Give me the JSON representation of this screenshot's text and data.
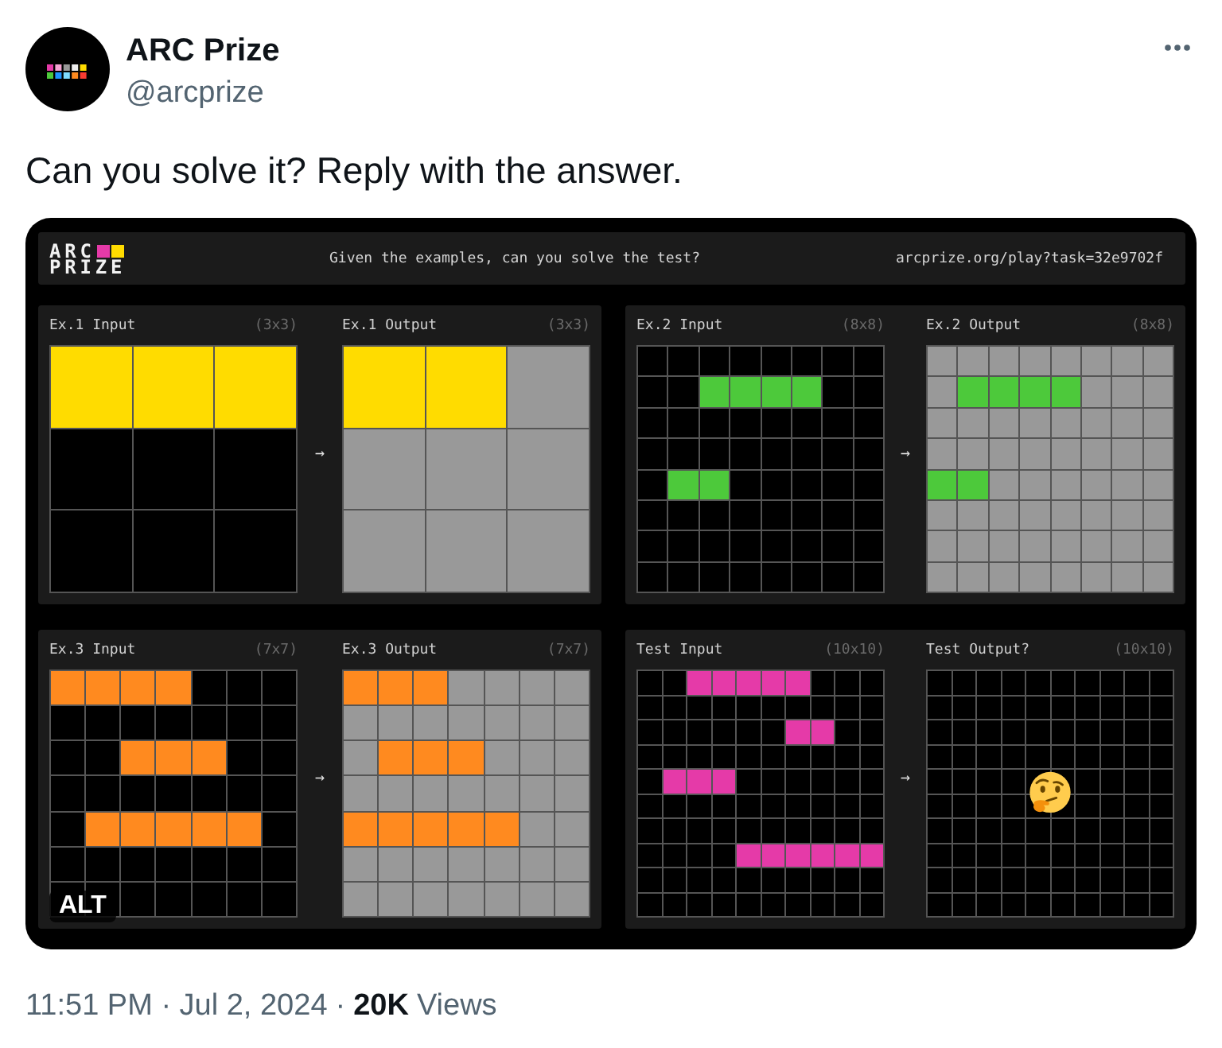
{
  "author": {
    "name": "ARC Prize",
    "handle": "@arcprize"
  },
  "tweet": {
    "text": "Can you solve it? Reply with the answer."
  },
  "media": {
    "header": {
      "logo_line_1": "ARC",
      "logo_line_2": "PRIZE",
      "prompt": "Given the examples, can you solve the test?",
      "url": "arcprize.org/play?task=32e9702f"
    },
    "panels": [
      {
        "kind": "example",
        "arrow": "→",
        "input": {
          "title": "Ex.1 Input",
          "size": "(3x3)",
          "rows": [
            {
              "cells": [
                {
                  "color": "#ffdc00"
                },
                {
                  "color": "#ffdc00"
                },
                {
                  "color": "#ffdc00"
                }
              ]
            },
            {
              "cells": [
                {
                  "color": "#000000"
                },
                {
                  "color": "#000000"
                },
                {
                  "color": "#000000"
                }
              ]
            },
            {
              "cells": [
                {
                  "color": "#000000"
                },
                {
                  "color": "#000000"
                },
                {
                  "color": "#000000"
                }
              ]
            }
          ]
        },
        "output": {
          "title": "Ex.1 Output",
          "size": "(3x3)",
          "rows": [
            {
              "cells": [
                {
                  "color": "#ffdc00"
                },
                {
                  "color": "#ffdc00"
                },
                {
                  "color": "#999999"
                }
              ]
            },
            {
              "cells": [
                {
                  "color": "#999999"
                },
                {
                  "color": "#999999"
                },
                {
                  "color": "#999999"
                }
              ]
            },
            {
              "cells": [
                {
                  "color": "#999999"
                },
                {
                  "color": "#999999"
                },
                {
                  "color": "#999999"
                }
              ]
            }
          ]
        }
      },
      {
        "kind": "example",
        "arrow": "→",
        "input": {
          "title": "Ex.2 Input",
          "size": "(8x8)",
          "rows": [
            {
              "cells": [
                {
                  "color": "#000000"
                },
                {
                  "color": "#000000"
                },
                {
                  "color": "#000000"
                },
                {
                  "color": "#000000"
                },
                {
                  "color": "#000000"
                },
                {
                  "color": "#000000"
                },
                {
                  "color": "#000000"
                },
                {
                  "color": "#000000"
                }
              ]
            },
            {
              "cells": [
                {
                  "color": "#000000"
                },
                {
                  "color": "#000000"
                },
                {
                  "color": "#4dc93b"
                },
                {
                  "color": "#4dc93b"
                },
                {
                  "color": "#4dc93b"
                },
                {
                  "color": "#4dc93b"
                },
                {
                  "color": "#000000"
                },
                {
                  "color": "#000000"
                }
              ]
            },
            {
              "cells": [
                {
                  "color": "#000000"
                },
                {
                  "color": "#000000"
                },
                {
                  "color": "#000000"
                },
                {
                  "color": "#000000"
                },
                {
                  "color": "#000000"
                },
                {
                  "color": "#000000"
                },
                {
                  "color": "#000000"
                },
                {
                  "color": "#000000"
                }
              ]
            },
            {
              "cells": [
                {
                  "color": "#000000"
                },
                {
                  "color": "#000000"
                },
                {
                  "color": "#000000"
                },
                {
                  "color": "#000000"
                },
                {
                  "color": "#000000"
                },
                {
                  "color": "#000000"
                },
                {
                  "color": "#000000"
                },
                {
                  "color": "#000000"
                }
              ]
            },
            {
              "cells": [
                {
                  "color": "#000000"
                },
                {
                  "color": "#4dc93b"
                },
                {
                  "color": "#4dc93b"
                },
                {
                  "color": "#000000"
                },
                {
                  "color": "#000000"
                },
                {
                  "color": "#000000"
                },
                {
                  "color": "#000000"
                },
                {
                  "color": "#000000"
                }
              ]
            },
            {
              "cells": [
                {
                  "color": "#000000"
                },
                {
                  "color": "#000000"
                },
                {
                  "color": "#000000"
                },
                {
                  "color": "#000000"
                },
                {
                  "color": "#000000"
                },
                {
                  "color": "#000000"
                },
                {
                  "color": "#000000"
                },
                {
                  "color": "#000000"
                }
              ]
            },
            {
              "cells": [
                {
                  "color": "#000000"
                },
                {
                  "color": "#000000"
                },
                {
                  "color": "#000000"
                },
                {
                  "color": "#000000"
                },
                {
                  "color": "#000000"
                },
                {
                  "color": "#000000"
                },
                {
                  "color": "#000000"
                },
                {
                  "color": "#000000"
                }
              ]
            },
            {
              "cells": [
                {
                  "color": "#000000"
                },
                {
                  "color": "#000000"
                },
                {
                  "color": "#000000"
                },
                {
                  "color": "#000000"
                },
                {
                  "color": "#000000"
                },
                {
                  "color": "#000000"
                },
                {
                  "color": "#000000"
                },
                {
                  "color": "#000000"
                }
              ]
            }
          ]
        },
        "output": {
          "title": "Ex.2 Output",
          "size": "(8x8)",
          "rows": [
            {
              "cells": [
                {
                  "color": "#999999"
                },
                {
                  "color": "#999999"
                },
                {
                  "color": "#999999"
                },
                {
                  "color": "#999999"
                },
                {
                  "color": "#999999"
                },
                {
                  "color": "#999999"
                },
                {
                  "color": "#999999"
                },
                {
                  "color": "#999999"
                }
              ]
            },
            {
              "cells": [
                {
                  "color": "#999999"
                },
                {
                  "color": "#4dc93b"
                },
                {
                  "color": "#4dc93b"
                },
                {
                  "color": "#4dc93b"
                },
                {
                  "color": "#4dc93b"
                },
                {
                  "color": "#999999"
                },
                {
                  "color": "#999999"
                },
                {
                  "color": "#999999"
                }
              ]
            },
            {
              "cells": [
                {
                  "color": "#999999"
                },
                {
                  "color": "#999999"
                },
                {
                  "color": "#999999"
                },
                {
                  "color": "#999999"
                },
                {
                  "color": "#999999"
                },
                {
                  "color": "#999999"
                },
                {
                  "color": "#999999"
                },
                {
                  "color": "#999999"
                }
              ]
            },
            {
              "cells": [
                {
                  "color": "#999999"
                },
                {
                  "color": "#999999"
                },
                {
                  "color": "#999999"
                },
                {
                  "color": "#999999"
                },
                {
                  "color": "#999999"
                },
                {
                  "color": "#999999"
                },
                {
                  "color": "#999999"
                },
                {
                  "color": "#999999"
                }
              ]
            },
            {
              "cells": [
                {
                  "color": "#4dc93b"
                },
                {
                  "color": "#4dc93b"
                },
                {
                  "color": "#999999"
                },
                {
                  "color": "#999999"
                },
                {
                  "color": "#999999"
                },
                {
                  "color": "#999999"
                },
                {
                  "color": "#999999"
                },
                {
                  "color": "#999999"
                }
              ]
            },
            {
              "cells": [
                {
                  "color": "#999999"
                },
                {
                  "color": "#999999"
                },
                {
                  "color": "#999999"
                },
                {
                  "color": "#999999"
                },
                {
                  "color": "#999999"
                },
                {
                  "color": "#999999"
                },
                {
                  "color": "#999999"
                },
                {
                  "color": "#999999"
                }
              ]
            },
            {
              "cells": [
                {
                  "color": "#999999"
                },
                {
                  "color": "#999999"
                },
                {
                  "color": "#999999"
                },
                {
                  "color": "#999999"
                },
                {
                  "color": "#999999"
                },
                {
                  "color": "#999999"
                },
                {
                  "color": "#999999"
                },
                {
                  "color": "#999999"
                }
              ]
            },
            {
              "cells": [
                {
                  "color": "#999999"
                },
                {
                  "color": "#999999"
                },
                {
                  "color": "#999999"
                },
                {
                  "color": "#999999"
                },
                {
                  "color": "#999999"
                },
                {
                  "color": "#999999"
                },
                {
                  "color": "#999999"
                },
                {
                  "color": "#999999"
                }
              ]
            }
          ]
        }
      },
      {
        "kind": "example",
        "arrow": "→",
        "input": {
          "title": "Ex.3 Input",
          "size": "(7x7)",
          "rows": [
            {
              "cells": [
                {
                  "color": "#ff8a1f"
                },
                {
                  "color": "#ff8a1f"
                },
                {
                  "color": "#ff8a1f"
                },
                {
                  "color": "#ff8a1f"
                },
                {
                  "color": "#000000"
                },
                {
                  "color": "#000000"
                },
                {
                  "color": "#000000"
                }
              ]
            },
            {
              "cells": [
                {
                  "color": "#000000"
                },
                {
                  "color": "#000000"
                },
                {
                  "color": "#000000"
                },
                {
                  "color": "#000000"
                },
                {
                  "color": "#000000"
                },
                {
                  "color": "#000000"
                },
                {
                  "color": "#000000"
                }
              ]
            },
            {
              "cells": [
                {
                  "color": "#000000"
                },
                {
                  "color": "#000000"
                },
                {
                  "color": "#ff8a1f"
                },
                {
                  "color": "#ff8a1f"
                },
                {
                  "color": "#ff8a1f"
                },
                {
                  "color": "#000000"
                },
                {
                  "color": "#000000"
                }
              ]
            },
            {
              "cells": [
                {
                  "color": "#000000"
                },
                {
                  "color": "#000000"
                },
                {
                  "color": "#000000"
                },
                {
                  "color": "#000000"
                },
                {
                  "color": "#000000"
                },
                {
                  "color": "#000000"
                },
                {
                  "color": "#000000"
                }
              ]
            },
            {
              "cells": [
                {
                  "color": "#000000"
                },
                {
                  "color": "#ff8a1f"
                },
                {
                  "color": "#ff8a1f"
                },
                {
                  "color": "#ff8a1f"
                },
                {
                  "color": "#ff8a1f"
                },
                {
                  "color": "#ff8a1f"
                },
                {
                  "color": "#000000"
                }
              ]
            },
            {
              "cells": [
                {
                  "color": "#000000"
                },
                {
                  "color": "#000000"
                },
                {
                  "color": "#000000"
                },
                {
                  "color": "#000000"
                },
                {
                  "color": "#000000"
                },
                {
                  "color": "#000000"
                },
                {
                  "color": "#000000"
                }
              ]
            },
            {
              "cells": [
                {
                  "color": "#000000"
                },
                {
                  "color": "#000000"
                },
                {
                  "color": "#000000"
                },
                {
                  "color": "#000000"
                },
                {
                  "color": "#000000"
                },
                {
                  "color": "#000000"
                },
                {
                  "color": "#000000"
                }
              ]
            }
          ]
        },
        "output": {
          "title": "Ex.3 Output",
          "size": "(7x7)",
          "rows": [
            {
              "cells": [
                {
                  "color": "#ff8a1f"
                },
                {
                  "color": "#ff8a1f"
                },
                {
                  "color": "#ff8a1f"
                },
                {
                  "color": "#999999"
                },
                {
                  "color": "#999999"
                },
                {
                  "color": "#999999"
                },
                {
                  "color": "#999999"
                }
              ]
            },
            {
              "cells": [
                {
                  "color": "#999999"
                },
                {
                  "color": "#999999"
                },
                {
                  "color": "#999999"
                },
                {
                  "color": "#999999"
                },
                {
                  "color": "#999999"
                },
                {
                  "color": "#999999"
                },
                {
                  "color": "#999999"
                }
              ]
            },
            {
              "cells": [
                {
                  "color": "#999999"
                },
                {
                  "color": "#ff8a1f"
                },
                {
                  "color": "#ff8a1f"
                },
                {
                  "color": "#ff8a1f"
                },
                {
                  "color": "#999999"
                },
                {
                  "color": "#999999"
                },
                {
                  "color": "#999999"
                }
              ]
            },
            {
              "cells": [
                {
                  "color": "#999999"
                },
                {
                  "color": "#999999"
                },
                {
                  "color": "#999999"
                },
                {
                  "color": "#999999"
                },
                {
                  "color": "#999999"
                },
                {
                  "color": "#999999"
                },
                {
                  "color": "#999999"
                }
              ]
            },
            {
              "cells": [
                {
                  "color": "#ff8a1f"
                },
                {
                  "color": "#ff8a1f"
                },
                {
                  "color": "#ff8a1f"
                },
                {
                  "color": "#ff8a1f"
                },
                {
                  "color": "#ff8a1f"
                },
                {
                  "color": "#999999"
                },
                {
                  "color": "#999999"
                }
              ]
            },
            {
              "cells": [
                {
                  "color": "#999999"
                },
                {
                  "color": "#999999"
                },
                {
                  "color": "#999999"
                },
                {
                  "color": "#999999"
                },
                {
                  "color": "#999999"
                },
                {
                  "color": "#999999"
                },
                {
                  "color": "#999999"
                }
              ]
            },
            {
              "cells": [
                {
                  "color": "#999999"
                },
                {
                  "color": "#999999"
                },
                {
                  "color": "#999999"
                },
                {
                  "color": "#999999"
                },
                {
                  "color": "#999999"
                },
                {
                  "color": "#999999"
                },
                {
                  "color": "#999999"
                }
              ]
            }
          ]
        }
      },
      {
        "kind": "test",
        "arrow": "→",
        "input": {
          "title": "Test Input",
          "size": "(10x10)",
          "rows": [
            {
              "cells": [
                {
                  "color": "#000000"
                },
                {
                  "color": "#000000"
                },
                {
                  "color": "#e53aa8"
                },
                {
                  "color": "#e53aa8"
                },
                {
                  "color": "#e53aa8"
                },
                {
                  "color": "#e53aa8"
                },
                {
                  "color": "#e53aa8"
                },
                {
                  "color": "#000000"
                },
                {
                  "color": "#000000"
                },
                {
                  "color": "#000000"
                }
              ]
            },
            {
              "cells": [
                {
                  "color": "#000000"
                },
                {
                  "color": "#000000"
                },
                {
                  "color": "#000000"
                },
                {
                  "color": "#000000"
                },
                {
                  "color": "#000000"
                },
                {
                  "color": "#000000"
                },
                {
                  "color": "#000000"
                },
                {
                  "color": "#000000"
                },
                {
                  "color": "#000000"
                },
                {
                  "color": "#000000"
                }
              ]
            },
            {
              "cells": [
                {
                  "color": "#000000"
                },
                {
                  "color": "#000000"
                },
                {
                  "color": "#000000"
                },
                {
                  "color": "#000000"
                },
                {
                  "color": "#000000"
                },
                {
                  "color": "#000000"
                },
                {
                  "color": "#e53aa8"
                },
                {
                  "color": "#e53aa8"
                },
                {
                  "color": "#000000"
                },
                {
                  "color": "#000000"
                }
              ]
            },
            {
              "cells": [
                {
                  "color": "#000000"
                },
                {
                  "color": "#000000"
                },
                {
                  "color": "#000000"
                },
                {
                  "color": "#000000"
                },
                {
                  "color": "#000000"
                },
                {
                  "color": "#000000"
                },
                {
                  "color": "#000000"
                },
                {
                  "color": "#000000"
                },
                {
                  "color": "#000000"
                },
                {
                  "color": "#000000"
                }
              ]
            },
            {
              "cells": [
                {
                  "color": "#000000"
                },
                {
                  "color": "#e53aa8"
                },
                {
                  "color": "#e53aa8"
                },
                {
                  "color": "#e53aa8"
                },
                {
                  "color": "#000000"
                },
                {
                  "color": "#000000"
                },
                {
                  "color": "#000000"
                },
                {
                  "color": "#000000"
                },
                {
                  "color": "#000000"
                },
                {
                  "color": "#000000"
                }
              ]
            },
            {
              "cells": [
                {
                  "color": "#000000"
                },
                {
                  "color": "#000000"
                },
                {
                  "color": "#000000"
                },
                {
                  "color": "#000000"
                },
                {
                  "color": "#000000"
                },
                {
                  "color": "#000000"
                },
                {
                  "color": "#000000"
                },
                {
                  "color": "#000000"
                },
                {
                  "color": "#000000"
                },
                {
                  "color": "#000000"
                }
              ]
            },
            {
              "cells": [
                {
                  "color": "#000000"
                },
                {
                  "color": "#000000"
                },
                {
                  "color": "#000000"
                },
                {
                  "color": "#000000"
                },
                {
                  "color": "#000000"
                },
                {
                  "color": "#000000"
                },
                {
                  "color": "#000000"
                },
                {
                  "color": "#000000"
                },
                {
                  "color": "#000000"
                },
                {
                  "color": "#000000"
                }
              ]
            },
            {
              "cells": [
                {
                  "color": "#000000"
                },
                {
                  "color": "#000000"
                },
                {
                  "color": "#000000"
                },
                {
                  "color": "#000000"
                },
                {
                  "color": "#e53aa8"
                },
                {
                  "color": "#e53aa8"
                },
                {
                  "color": "#e53aa8"
                },
                {
                  "color": "#e53aa8"
                },
                {
                  "color": "#e53aa8"
                },
                {
                  "color": "#e53aa8"
                }
              ]
            },
            {
              "cells": [
                {
                  "color": "#000000"
                },
                {
                  "color": "#000000"
                },
                {
                  "color": "#000000"
                },
                {
                  "color": "#000000"
                },
                {
                  "color": "#000000"
                },
                {
                  "color": "#000000"
                },
                {
                  "color": "#000000"
                },
                {
                  "color": "#000000"
                },
                {
                  "color": "#000000"
                },
                {
                  "color": "#000000"
                }
              ]
            },
            {
              "cells": [
                {
                  "color": "#000000"
                },
                {
                  "color": "#000000"
                },
                {
                  "color": "#000000"
                },
                {
                  "color": "#000000"
                },
                {
                  "color": "#000000"
                },
                {
                  "color": "#000000"
                },
                {
                  "color": "#000000"
                },
                {
                  "color": "#000000"
                },
                {
                  "color": "#000000"
                },
                {
                  "color": "#000000"
                }
              ]
            }
          ]
        },
        "output": {
          "title": "Test Output?",
          "size": "(10x10)",
          "rows": [
            {
              "cells": [
                {
                  "color": "#000000"
                },
                {
                  "color": "#000000"
                },
                {
                  "color": "#000000"
                },
                {
                  "color": "#000000"
                },
                {
                  "color": "#000000"
                },
                {
                  "color": "#000000"
                },
                {
                  "color": "#000000"
                },
                {
                  "color": "#000000"
                },
                {
                  "color": "#000000"
                },
                {
                  "color": "#000000"
                }
              ]
            },
            {
              "cells": [
                {
                  "color": "#000000"
                },
                {
                  "color": "#000000"
                },
                {
                  "color": "#000000"
                },
                {
                  "color": "#000000"
                },
                {
                  "color": "#000000"
                },
                {
                  "color": "#000000"
                },
                {
                  "color": "#000000"
                },
                {
                  "color": "#000000"
                },
                {
                  "color": "#000000"
                },
                {
                  "color": "#000000"
                }
              ]
            },
            {
              "cells": [
                {
                  "color": "#000000"
                },
                {
                  "color": "#000000"
                },
                {
                  "color": "#000000"
                },
                {
                  "color": "#000000"
                },
                {
                  "color": "#000000"
                },
                {
                  "color": "#000000"
                },
                {
                  "color": "#000000"
                },
                {
                  "color": "#000000"
                },
                {
                  "color": "#000000"
                },
                {
                  "color": "#000000"
                }
              ]
            },
            {
              "cells": [
                {
                  "color": "#000000"
                },
                {
                  "color": "#000000"
                },
                {
                  "color": "#000000"
                },
                {
                  "color": "#000000"
                },
                {
                  "color": "#000000"
                },
                {
                  "color": "#000000"
                },
                {
                  "color": "#000000"
                },
                {
                  "color": "#000000"
                },
                {
                  "color": "#000000"
                },
                {
                  "color": "#000000"
                }
              ]
            },
            {
              "cells": [
                {
                  "color": "#000000"
                },
                {
                  "color": "#000000"
                },
                {
                  "color": "#000000"
                },
                {
                  "color": "#000000"
                },
                {
                  "color": "#000000"
                },
                {
                  "color": "#000000"
                },
                {
                  "color": "#000000"
                },
                {
                  "color": "#000000"
                },
                {
                  "color": "#000000"
                },
                {
                  "color": "#000000"
                }
              ]
            },
            {
              "cells": [
                {
                  "color": "#000000"
                },
                {
                  "color": "#000000"
                },
                {
                  "color": "#000000"
                },
                {
                  "color": "#000000"
                },
                {
                  "color": "#000000"
                },
                {
                  "color": "#000000"
                },
                {
                  "color": "#000000"
                },
                {
                  "color": "#000000"
                },
                {
                  "color": "#000000"
                },
                {
                  "color": "#000000"
                }
              ]
            },
            {
              "cells": [
                {
                  "color": "#000000"
                },
                {
                  "color": "#000000"
                },
                {
                  "color": "#000000"
                },
                {
                  "color": "#000000"
                },
                {
                  "color": "#000000"
                },
                {
                  "color": "#000000"
                },
                {
                  "color": "#000000"
                },
                {
                  "color": "#000000"
                },
                {
                  "color": "#000000"
                },
                {
                  "color": "#000000"
                }
              ]
            },
            {
              "cells": [
                {
                  "color": "#000000"
                },
                {
                  "color": "#000000"
                },
                {
                  "color": "#000000"
                },
                {
                  "color": "#000000"
                },
                {
                  "color": "#000000"
                },
                {
                  "color": "#000000"
                },
                {
                  "color": "#000000"
                },
                {
                  "color": "#000000"
                },
                {
                  "color": "#000000"
                },
                {
                  "color": "#000000"
                }
              ]
            },
            {
              "cells": [
                {
                  "color": "#000000"
                },
                {
                  "color": "#000000"
                },
                {
                  "color": "#000000"
                },
                {
                  "color": "#000000"
                },
                {
                  "color": "#000000"
                },
                {
                  "color": "#000000"
                },
                {
                  "color": "#000000"
                },
                {
                  "color": "#000000"
                },
                {
                  "color": "#000000"
                },
                {
                  "color": "#000000"
                }
              ]
            },
            {
              "cells": [
                {
                  "color": "#000000"
                },
                {
                  "color": "#000000"
                },
                {
                  "color": "#000000"
                },
                {
                  "color": "#000000"
                },
                {
                  "color": "#000000"
                },
                {
                  "color": "#000000"
                },
                {
                  "color": "#000000"
                },
                {
                  "color": "#000000"
                },
                {
                  "color": "#000000"
                },
                {
                  "color": "#000000"
                }
              ]
            }
          ]
        }
      }
    ],
    "alt_badge": "ALT"
  },
  "footer": {
    "timestamp": "11:51 PM · Jul 2, 2024",
    "separator": "·",
    "views_count": "20K",
    "views_label": "Views"
  }
}
